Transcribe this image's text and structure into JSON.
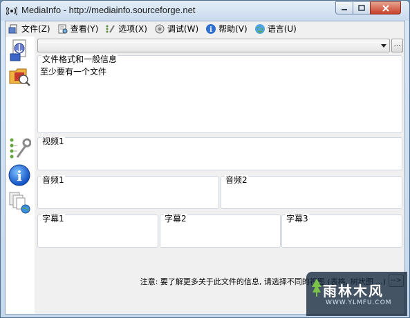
{
  "window": {
    "title": "MediaInfo - http://mediainfo.sourceforge.net"
  },
  "menu": {
    "items": [
      {
        "label": "文件(Z)",
        "icon": "file-icon"
      },
      {
        "label": "查看(Y)",
        "icon": "view-icon"
      },
      {
        "label": "选项(X)",
        "icon": "options-icon"
      },
      {
        "label": "调试(W)",
        "icon": "debug-icon"
      },
      {
        "label": "帮助(V)",
        "icon": "help-icon"
      },
      {
        "label": "语言(U)",
        "icon": "language-icon"
      }
    ]
  },
  "toolbar": {
    "combo_value": "",
    "browse_label": "..."
  },
  "sidebar": {
    "items": [
      {
        "icon": "open-file-icon"
      },
      {
        "icon": "open-folder-icon"
      },
      {
        "icon": "preferences-icon"
      },
      {
        "icon": "about-icon"
      },
      {
        "icon": "web-info-icon"
      }
    ]
  },
  "groups": {
    "general": {
      "legend": "文件格式和一般信息",
      "content": "至少要有一个文件"
    },
    "video1": {
      "legend": "视频1"
    },
    "audio1": {
      "legend": "音频1"
    },
    "audio2": {
      "legend": "音频2"
    },
    "text1": {
      "legend": "字幕1"
    },
    "text2": {
      "legend": "字幕2"
    },
    "text3": {
      "legend": "字幕3"
    }
  },
  "footer": {
    "note": "注意: 要了解更多关于此文件的信息, 请选择不同的视图 (表格, 树状图 ...)",
    "next_label": "-->"
  },
  "watermark": {
    "title": "雨林木风",
    "subtitle": "WWW.YLMFU.COM"
  },
  "colors": {
    "window_frame": "#c4d7ec",
    "close_button": "#c7412b",
    "panel_bg": "#ffffff"
  }
}
